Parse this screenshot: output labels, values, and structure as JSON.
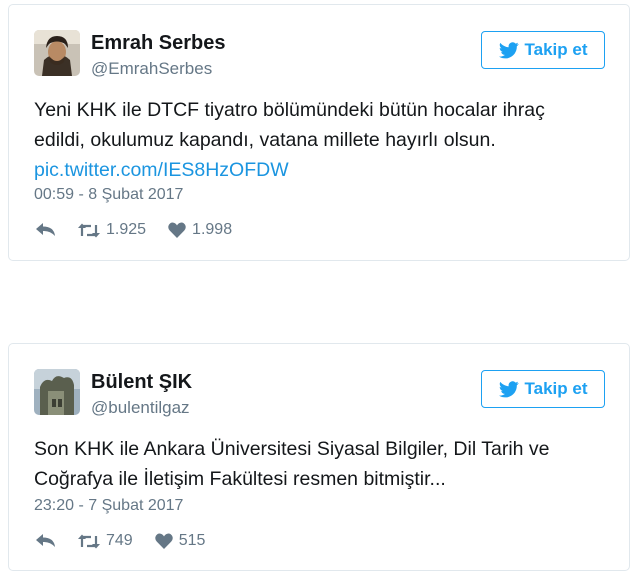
{
  "tweets": [
    {
      "name": "Emrah Serbes",
      "handle": "@EmrahSerbes",
      "follow_label": "Takip et",
      "text_lines": [
        "Yeni KHK ile DTCF tiyatro bölümündeki bütün hocalar ihraç",
        "edildi, okulumuz kapandı, vatana millete hayırlı olsun."
      ],
      "link": "pic.twitter.com/IES8HzOFDW",
      "timestamp": "00:59 - 8 Şubat 2017",
      "retweets": "1.925",
      "likes": "1.998",
      "icons": {
        "reply": "reply-icon",
        "retweet": "retweet-icon",
        "like": "heart-icon",
        "follow": "twitter-bird-icon"
      }
    },
    {
      "name": "Bülent ŞIK",
      "handle": "@bulentilgaz",
      "follow_label": "Takip et",
      "text_lines": [
        "Son KHK ile Ankara Üniversitesi Siyasal Bilgiler, Dil Tarih ve",
        "Coğrafya ile İletişim Fakültesi resmen bitmiştir..."
      ],
      "timestamp": "23:20 - 7 Şubat 2017",
      "retweets": "749",
      "likes": "515",
      "icons": {
        "reply": "reply-icon",
        "retweet": "retweet-icon",
        "like": "heart-icon",
        "follow": "twitter-bird-icon"
      }
    }
  ],
  "colors": {
    "accent": "#1da1f2",
    "link": "#1b95e0",
    "muted": "#657786",
    "border": "#e1e8ed",
    "text": "#14171a"
  }
}
